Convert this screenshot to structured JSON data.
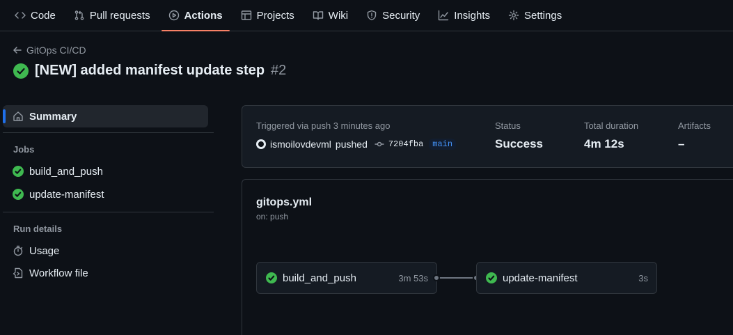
{
  "nav": {
    "tabs": [
      {
        "label": "Code",
        "icon": "code-icon"
      },
      {
        "label": "Pull requests",
        "icon": "pull-request-icon"
      },
      {
        "label": "Actions",
        "icon": "play-icon"
      },
      {
        "label": "Projects",
        "icon": "table-icon"
      },
      {
        "label": "Wiki",
        "icon": "book-icon"
      },
      {
        "label": "Security",
        "icon": "shield-icon"
      },
      {
        "label": "Insights",
        "icon": "graph-icon"
      },
      {
        "label": "Settings",
        "icon": "gear-icon"
      }
    ],
    "active": "Actions"
  },
  "header": {
    "back_label": "GitOps CI/CD",
    "title": "[NEW] added manifest update step",
    "run_number": "#2"
  },
  "sidebar": {
    "summary": "Summary",
    "jobs_heading": "Jobs",
    "jobs": [
      "build_and_push",
      "update-manifest"
    ],
    "run_details_heading": "Run details",
    "usage": "Usage",
    "workflow_file": "Workflow file"
  },
  "run_info": {
    "triggered": "Triggered via push 3 minutes ago",
    "actor": "ismoilovdevml",
    "action": "pushed",
    "sha": "7204fba",
    "branch": "main",
    "status_label": "Status",
    "status_value": "Success",
    "duration_label": "Total duration",
    "duration_value": "4m 12s",
    "artifacts_label": "Artifacts",
    "artifacts_value": "–"
  },
  "workflow": {
    "file": "gitops.yml",
    "trigger": "on: push",
    "jobs": [
      {
        "name": "build_and_push",
        "duration": "3m 53s"
      },
      {
        "name": "update-manifest",
        "duration": "3s"
      }
    ]
  },
  "colors": {
    "background": "#0d1117",
    "success": "#3fb950",
    "active_tab_underline": "#f78166",
    "accent": "#1f6feb",
    "branch": "#4493f8"
  }
}
